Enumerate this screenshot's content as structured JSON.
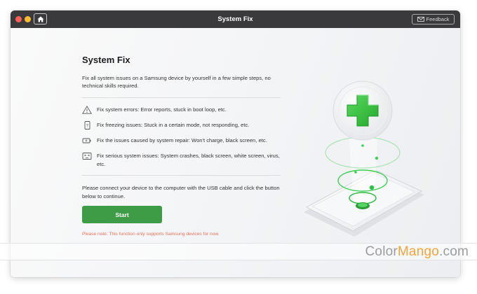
{
  "window": {
    "title": "System Fix",
    "feedback_label": "Feedback"
  },
  "main": {
    "heading": "System Fix",
    "intro": "Fix all system issues on a Samsung device by yourself in a few simple steps, no technical skills required.",
    "issues": [
      {
        "icon": "warning-triangle-icon",
        "text": "Fix system errors: Error reports, stuck in boot loop, etc."
      },
      {
        "icon": "frozen-phone-icon",
        "text": "Fix freezing issues: Stuck in a certain mode, not responding, etc."
      },
      {
        "icon": "battery-charge-icon",
        "text": "Fix the issues caused by system repair: Won't charge, black screen, etc."
      },
      {
        "icon": "crashed-screen-icon",
        "text": "Fix serious system issues: System crashes, black screen, white screen, virus, etc."
      }
    ],
    "connect_text": "Please connect your device to the computer with the USB cable and click the button below to continue.",
    "start_label": "Start",
    "note": "Please note:  This function only supports Samsung devices for now."
  },
  "watermark": {
    "part1": "Color",
    "part2": "Mango",
    "part3": ".com"
  },
  "colors": {
    "accent_green": "#3d9c45",
    "titlebar": "#3a3a3c",
    "note": "#e8705a"
  }
}
